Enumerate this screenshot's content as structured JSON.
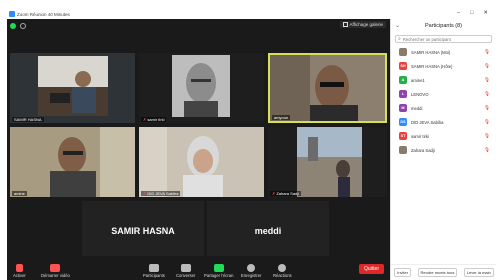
{
  "window": {
    "title": "Zoom Réunion 40 Minutes"
  },
  "top": {
    "gallery_label": "Affichage galerie"
  },
  "tiles": [
    {
      "name": "SAMIR HASNA",
      "muted": false
    },
    {
      "name": "samir tirki",
      "muted": true
    },
    {
      "name": "amyoun",
      "muted": false
    },
    {
      "name": "amine",
      "muted": false
    },
    {
      "name": "DID JEVA Sabiha",
      "muted": true
    },
    {
      "name": "Zahara Sadji",
      "muted": true
    },
    {
      "name": "SAMIR HASNA",
      "big": "SAMIR HASNA"
    },
    {
      "name": "meddi",
      "big": "meddi"
    }
  ],
  "toolbar": {
    "audio": "Activer",
    "video": "Démarrer vidéo",
    "participants": "Participants",
    "chat": "Converser",
    "share": "Partager l'écran",
    "record": "Enregistrer",
    "reactions": "Réactions",
    "end": "Quitter"
  },
  "panel": {
    "title": "Participants (8)",
    "search_placeholder": "Rechercher un participant",
    "participants": [
      {
        "initials": "",
        "name": "SAMIR HASNA (Moi)",
        "color": "#666666",
        "photo": true
      },
      {
        "initials": "SH",
        "name": "SAMIR HASNA (Hôte)",
        "color": "#e8413f"
      },
      {
        "initials": "A",
        "name": "amine1",
        "color": "#23b04a"
      },
      {
        "initials": "L",
        "name": "LENOVO",
        "color": "#8e44ad"
      },
      {
        "initials": "M",
        "name": "meddi",
        "color": "#8e44ad"
      },
      {
        "initials": "DS",
        "name": "DID JEVA Sabiha",
        "color": "#2d8cff"
      },
      {
        "initials": "ST",
        "name": "samir tirki",
        "color": "#e8413f"
      },
      {
        "initials": "",
        "name": "Zahara Sadji",
        "color": "#666666",
        "photo": true
      }
    ],
    "footer": {
      "invite": "Inviter",
      "mute_all": "Rendre muets tous",
      "more": "Lever la main"
    }
  },
  "colors": {
    "accent": "#2d8cff",
    "end": "#e02828",
    "share": "#23d959",
    "active_speaker": "#d4e157"
  }
}
